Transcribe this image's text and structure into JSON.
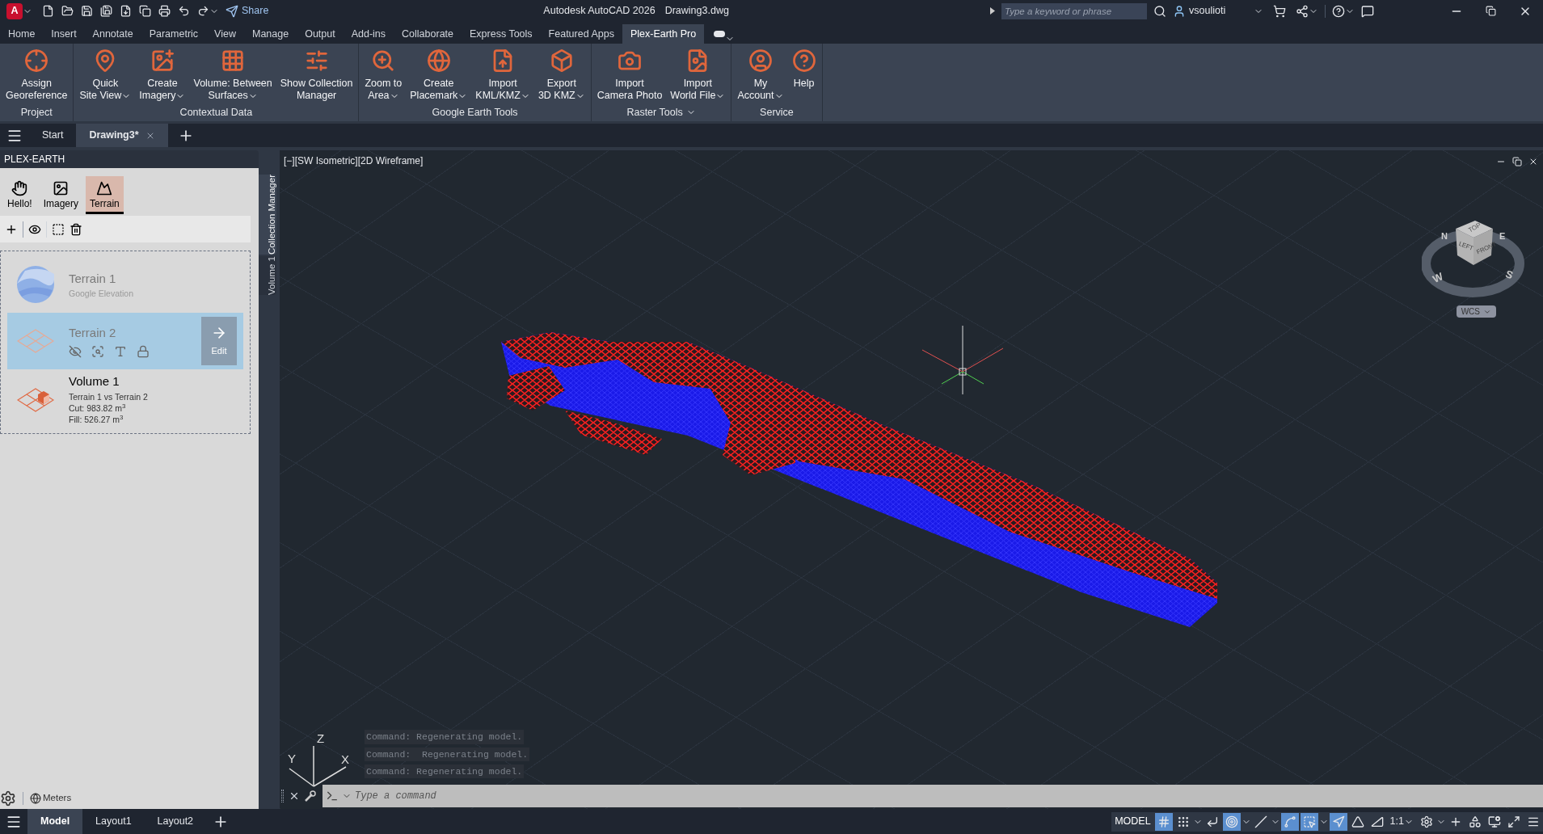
{
  "title_bar": {
    "logo": "A",
    "share": "Share",
    "app": "Autodesk AutoCAD 2026",
    "file": "Drawing3.dwg",
    "search": {
      "placeholder": "Type a keyword or phrase"
    },
    "user": "vsoulioti"
  },
  "ribbon_tabs": [
    {
      "label": "Home",
      "selected": false
    },
    {
      "label": "Insert",
      "selected": false
    },
    {
      "label": "Annotate",
      "selected": false
    },
    {
      "label": "Parametric",
      "selected": false
    },
    {
      "label": "View",
      "selected": false
    },
    {
      "label": "Manage",
      "selected": false
    },
    {
      "label": "Output",
      "selected": false
    },
    {
      "label": "Add-ins",
      "selected": false
    },
    {
      "label": "Collaborate",
      "selected": false
    },
    {
      "label": "Express Tools",
      "selected": false
    },
    {
      "label": "Featured Apps",
      "selected": false
    },
    {
      "label": "Plex-Earth Pro",
      "selected": true
    }
  ],
  "ribbon_panels": [
    {
      "title": "Project",
      "dropdown": false,
      "buttons": [
        {
          "lines": [
            "Assign",
            "Georeference"
          ],
          "dropdown": false
        }
      ]
    },
    {
      "title": "Contextual Data",
      "dropdown": false,
      "buttons": [
        {
          "lines": [
            "Quick",
            "Site View"
          ],
          "dropdown": true
        },
        {
          "lines": [
            "Create",
            "Imagery"
          ],
          "dropdown": true
        },
        {
          "lines": [
            "Volume: Between",
            "Surfaces"
          ],
          "dropdown": true
        },
        {
          "lines": [
            "Show Collection",
            "Manager"
          ],
          "dropdown": false
        }
      ]
    },
    {
      "title": "Google Earth Tools",
      "dropdown": false,
      "buttons": [
        {
          "lines": [
            "Zoom to",
            "Area"
          ],
          "dropdown": true
        },
        {
          "lines": [
            "Create",
            "Placemark"
          ],
          "dropdown": true
        },
        {
          "lines": [
            "Import",
            "KML/KMZ"
          ],
          "dropdown": true
        },
        {
          "lines": [
            "Export",
            "3D KMZ"
          ],
          "dropdown": true
        }
      ]
    },
    {
      "title": "Raster Tools",
      "dropdown": true,
      "buttons": [
        {
          "lines": [
            "Import",
            "Camera Photo"
          ],
          "dropdown": false
        },
        {
          "lines": [
            "Import",
            "World File"
          ],
          "dropdown": true
        }
      ]
    },
    {
      "title": "Service",
      "dropdown": false,
      "buttons": [
        {
          "lines": [
            "My",
            "Account"
          ],
          "dropdown": true
        },
        {
          "lines": [
            "Help"
          ],
          "dropdown": false
        }
      ]
    }
  ],
  "doc_tabs": [
    {
      "label": "Start",
      "selected": false,
      "closable": false
    },
    {
      "label": "Drawing3*",
      "selected": true,
      "closable": true
    }
  ],
  "panel": {
    "title": "PLEX-EARTH",
    "tabs": [
      {
        "label": "Hello!",
        "selected": false
      },
      {
        "label": "Imagery",
        "selected": false
      },
      {
        "label": "Terrain",
        "selected": true
      }
    ],
    "items": [
      {
        "kind": "terrain",
        "name": "Terrain 1",
        "details": [
          "Google Elevation"
        ],
        "selected": false,
        "dimmed": true
      },
      {
        "kind": "grid",
        "name": "Terrain 2",
        "selected": true,
        "dimmed": true,
        "action": "Edit"
      },
      {
        "kind": "volume",
        "name": "Volume 1",
        "details": [
          "Terrain 1 vs Terrain 2",
          "Cut: 983.82 m$^{3}$",
          "Fill: 526.27 m$^{3}$"
        ],
        "selected": false,
        "dimmed": false
      }
    ],
    "units": "Meters"
  },
  "side_tabs": [
    {
      "label": "Collection Manager",
      "selected": true
    },
    {
      "label": "Volume 1",
      "selected": false
    }
  ],
  "viewport": {
    "label": "[−][SW Isometric][2D Wireframe]",
    "cube_faces": [
      "TOP",
      "LEFT",
      "FRONT"
    ],
    "compass": [
      "N",
      "E",
      "W",
      "S"
    ],
    "ucs_menu": "WCS",
    "axes": [
      "X",
      "Y",
      "Z"
    ]
  },
  "command_line": {
    "history": [
      "Command: Regenerating model.",
      "Command:  Regenerating model.",
      "Command: Regenerating model."
    ],
    "placeholder": "Type a command"
  },
  "layout_tabs": [
    {
      "label": "Model",
      "selected": true
    },
    {
      "label": "Layout1",
      "selected": false
    },
    {
      "label": "Layout2",
      "selected": false
    }
  ],
  "status_bar": {
    "space": "MODEL",
    "scale": "1:1",
    "toggles": [
      {
        "on": true
      },
      {
        "on": false
      },
      {
        "on": false
      },
      {
        "on": true
      },
      {
        "on": false
      },
      {
        "on": true
      },
      {
        "on": true
      },
      {
        "on": true
      },
      {
        "on": false
      },
      {
        "on": false
      }
    ]
  }
}
